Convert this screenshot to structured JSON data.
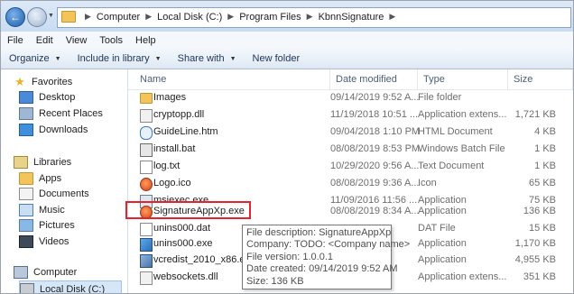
{
  "breadcrumb": [
    "Computer",
    "Local Disk (C:)",
    "Program Files",
    "KbnnSignature"
  ],
  "menu": [
    "File",
    "Edit",
    "View",
    "Tools",
    "Help"
  ],
  "toolbar": {
    "organize": "Organize",
    "include_in_library": "Include in library",
    "share_with": "Share with",
    "new_folder": "New folder"
  },
  "sidebar": {
    "favorites_header": "Favorites",
    "favorites": [
      "Desktop",
      "Recent Places",
      "Downloads"
    ],
    "libraries_header": "Libraries",
    "libraries": [
      "Apps",
      "Documents",
      "Music",
      "Pictures",
      "Videos"
    ],
    "computer_header": "Computer",
    "drive": "Local Disk (C:)"
  },
  "columns": {
    "name": "Name",
    "date": "Date modified",
    "type": "Type",
    "size": "Size"
  },
  "files": [
    {
      "name": "Images",
      "date": "09/14/2019 9:52 A...",
      "type": "File folder",
      "size": "",
      "icon": "folder-icon"
    },
    {
      "name": "cryptopp.dll",
      "date": "11/19/2018 10:51 ...",
      "type": "Application extens...",
      "size": "1,721 KB",
      "icon": "dll-file-icon"
    },
    {
      "name": "GuideLine.htm",
      "date": "09/04/2018 1:10 PM",
      "type": "HTML Document",
      "size": "4 KB",
      "icon": "html-file-icon"
    },
    {
      "name": "install.bat",
      "date": "08/08/2019 8:53 PM",
      "type": "Windows Batch File",
      "size": "1 KB",
      "icon": "batch-file-icon"
    },
    {
      "name": "log.txt",
      "date": "10/29/2020 9:56 A...",
      "type": "Text Document",
      "size": "1 KB",
      "icon": "text-file-icon"
    },
    {
      "name": "Logo.ico",
      "date": "08/08/2019 9:36 A...",
      "type": "Icon",
      "size": "65 KB",
      "icon": "logo-icon"
    },
    {
      "name": "msiexec.exe",
      "date": "11/09/2016 11:56 ...",
      "type": "Application",
      "size": "75 KB",
      "icon": "exe-file-icon"
    },
    {
      "name": "SignatureAppXp.exe",
      "date": "08/08/2019 8:34 A...",
      "type": "Application",
      "size": "136 KB",
      "icon": "signature-app-icon"
    },
    {
      "name": "unins000.dat",
      "date": "",
      "type": "DAT File",
      "size": "15 KB",
      "icon": "dat-file-icon"
    },
    {
      "name": "unins000.exe",
      "date": "",
      "type": "Application",
      "size": "1,170 KB",
      "icon": "uninstaller-icon"
    },
    {
      "name": "vcredist_2010_x86.exe",
      "date": "",
      "type": "Application",
      "size": "4,955 KB",
      "icon": "installer-icon"
    },
    {
      "name": "websockets.dll",
      "date": "",
      "type": "Application extens...",
      "size": "351 KB",
      "icon": "dll-file-icon"
    }
  ],
  "tooltip": {
    "description": "File description: SignatureAppXp",
    "company": "Company: TODO: <Company name>",
    "version": "File version: 1.0.0.1",
    "created": "Date created: 09/14/2019 9:52 AM",
    "size": "Size: 136 KB"
  }
}
